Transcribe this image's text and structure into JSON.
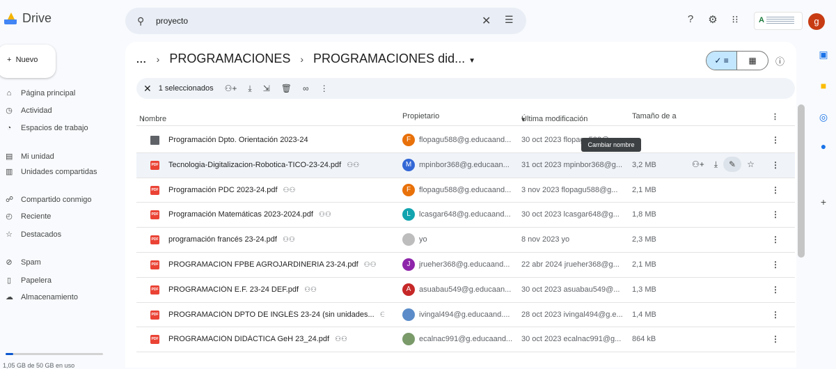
{
  "app": {
    "name": "Drive"
  },
  "search": {
    "query": "proyecto",
    "clear_icon": "close-icon",
    "filter_icon": "tune-icon"
  },
  "top_icons": [
    "help-icon",
    "settings-icon",
    "apps-icon"
  ],
  "org_badge": "A",
  "user": {
    "initial": "g",
    "color": "#c83c14"
  },
  "sidebar": {
    "new_label": "Nuevo",
    "items": [
      {
        "label": "Página principal",
        "icon": "home-icon",
        "glyph": "⌂"
      },
      {
        "label": "Actividad",
        "icon": "activity-icon",
        "glyph": "◷"
      },
      {
        "label": "Espacios de trabajo",
        "icon": "workspaces-icon",
        "glyph": "◔"
      },
      {
        "label": "Mi unidad",
        "icon": "my-drive-icon",
        "glyph": "▤"
      },
      {
        "label": "Unidades compartidas",
        "icon": "shared-drives-icon",
        "glyph": "▥"
      },
      {
        "label": "Compartido conmigo",
        "icon": "shared-with-me-icon",
        "glyph": "☍"
      },
      {
        "label": "Reciente",
        "icon": "recent-icon",
        "glyph": "◴"
      },
      {
        "label": "Destacados",
        "icon": "star-icon",
        "glyph": "☆"
      },
      {
        "label": "Spam",
        "icon": "spam-icon",
        "glyph": "⊘"
      },
      {
        "label": "Papelera",
        "icon": "trash-icon",
        "glyph": "▯"
      },
      {
        "label": "Almacenamiento",
        "icon": "cloud-icon",
        "glyph": "☁"
      }
    ],
    "storage_text": "1,05 GB de 50 GB en uso",
    "storage_fraction": 0.021
  },
  "breadcrumb": {
    "more": "...",
    "parent": "PROGRAMACIONES",
    "current": "PROGRAMACIONES did..."
  },
  "selection_bar": {
    "count_label": "1 seleccionados",
    "actions": [
      "share-icon",
      "download-icon",
      "move-icon",
      "delete-icon",
      "link-icon",
      "more-icon"
    ]
  },
  "columns": {
    "name": "Nombre",
    "owner": "Propietario",
    "modified": "Última modificación",
    "size": "Tamaño de a"
  },
  "files": [
    {
      "type": "folder",
      "name": "Programación Dpto. Orientación 2023-24",
      "shared": false,
      "owner_initial": "F",
      "owner_color": "#e8710a",
      "owner": "flopagu588@g.educaand...",
      "modified": "30 oct 2023 flopagu588@g...",
      "size": "—"
    },
    {
      "type": "pdf",
      "name": "Tecnologia-Digitalizacion-Robotica-TICO-23-24.pdf",
      "shared": true,
      "owner_initial": "M",
      "owner_color": "#3367d6",
      "owner": "mpinbor368@g.educaan...",
      "modified": "31 oct 2023 mpinbor368@g...",
      "size": "3,2 MB",
      "selected": true
    },
    {
      "type": "pdf",
      "name": "Programación PDC 2023-24.pdf",
      "shared": true,
      "owner_initial": "F",
      "owner_color": "#e8710a",
      "owner": "flopagu588@g.educaand...",
      "modified": "3 nov 2023 flopagu588@g...",
      "size": "2,1 MB"
    },
    {
      "type": "pdf",
      "name": "Programación Matemáticas 2023-2024.pdf",
      "shared": true,
      "owner_initial": "L",
      "owner_color": "#12a4af",
      "owner": "lcasgar648@g.educaand...",
      "modified": "30 oct 2023 lcasgar648@g...",
      "size": "1,8 MB"
    },
    {
      "type": "pdf",
      "name": "programación francés 23-24.pdf",
      "shared": true,
      "owner_initial": "",
      "owner_color": "#bdbdbd",
      "owner": "yo",
      "modified": "8 nov 2023 yo",
      "size": "2,3 MB"
    },
    {
      "type": "pdf",
      "name": "PROGRAMACION FPBE AGROJARDINERIA 23-24.pdf",
      "shared": true,
      "owner_initial": "J",
      "owner_color": "#8e24aa",
      "owner": "jrueher368@g.educaand...",
      "modified": "22 abr 2024 jrueher368@g...",
      "size": "2,1 MB"
    },
    {
      "type": "pdf",
      "name": "PROGRAMACIÓN E.F. 23-24 DEF.pdf",
      "shared": true,
      "owner_initial": "A",
      "owner_color": "#c62828",
      "owner": "asuabau549@g.educaan...",
      "modified": "30 oct 2023 asuabau549@...",
      "size": "1,3 MB"
    },
    {
      "type": "pdf",
      "name": "PROGRAMACIÓN DPTO DE INGLÉS 23-24 (sin unidades...",
      "shared": true,
      "owner_initial": "",
      "owner_color": "#5b8cc9",
      "owner": "ivingal494@g.educaand....",
      "modified": "28 oct 2023 ivingal494@g.e...",
      "size": "1,4 MB"
    },
    {
      "type": "pdf",
      "name": "PROGRAMACIÓN DIDÁCTICA GeH 23_24.pdf",
      "shared": true,
      "owner_initial": "",
      "owner_color": "#7a9a6a",
      "owner": "ecalnac991@g.educaand...",
      "modified": "30 oct 2023 ecalnac991@g...",
      "size": "864 kB"
    }
  ],
  "tooltip": "Cambiar nombre",
  "right_apps": [
    {
      "icon": "calendar-icon",
      "color": "#1a73e8"
    },
    {
      "icon": "keep-icon",
      "color": "#fbbc04"
    },
    {
      "icon": "tasks-icon",
      "color": "#1a73e8"
    },
    {
      "icon": "contacts-icon",
      "color": "#1a73e8"
    },
    {
      "icon": "add-icon",
      "color": "#444746"
    }
  ]
}
